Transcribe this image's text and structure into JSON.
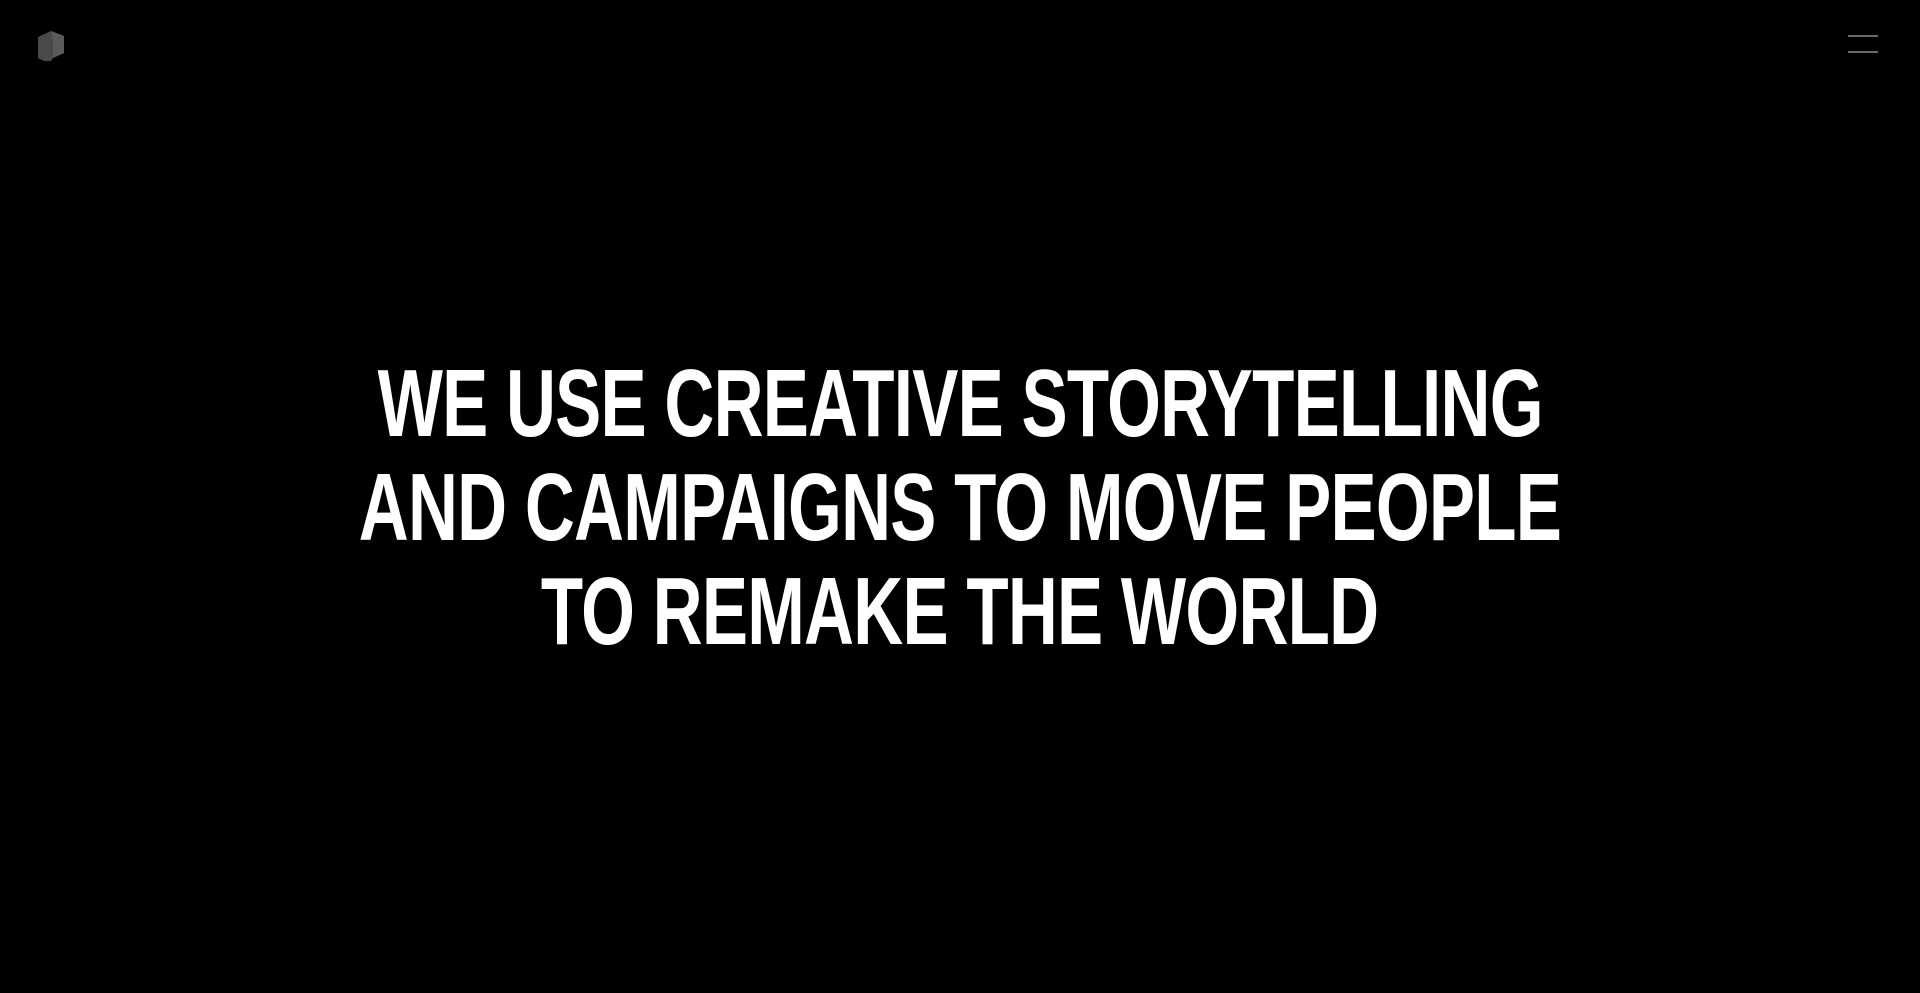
{
  "header": {
    "logo_icon": "cube-logo-icon",
    "menu_icon": "hamburger-menu-icon"
  },
  "hero": {
    "lines": [
      "WE USE CREATIVE STORYTELLING",
      "AND CAMPAIGNS TO MOVE PEOPLE",
      "TO REMAKE THE WORLD"
    ]
  },
  "colors": {
    "background": "#000000",
    "text": "#ffffff",
    "logo": "#4a4a4a",
    "menu": "#6a6a6a"
  }
}
